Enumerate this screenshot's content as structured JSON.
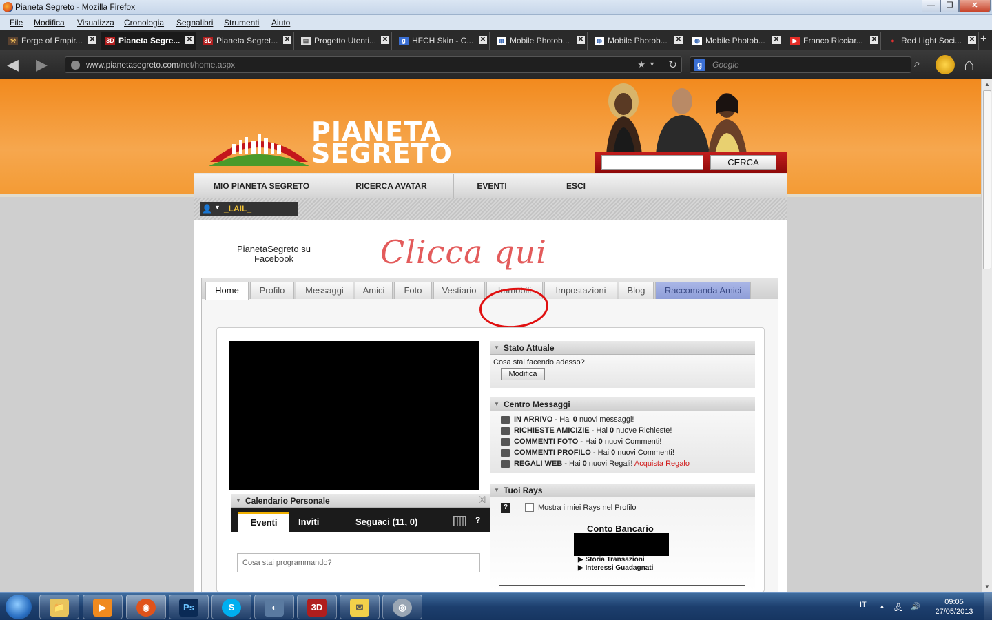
{
  "window": {
    "title": "Pianeta Segreto - Mozilla Firefox",
    "controls": {
      "minimize": "—",
      "maximize": "❐",
      "close": "✕"
    }
  },
  "menu": [
    "File",
    "Modifica",
    "Visualizza",
    "Cronologia",
    "Segnalibri",
    "Strumenti",
    "Aiuto"
  ],
  "tabs": [
    {
      "label": "Forge of Empir...",
      "icon": "forge-icon",
      "active": false
    },
    {
      "label": "Pianeta Segre...",
      "icon": "3d-icon",
      "active": true
    },
    {
      "label": "Pianeta Segret...",
      "icon": "3d-icon",
      "active": false
    },
    {
      "label": "Progetto Utenti...",
      "icon": "page-icon",
      "active": false
    },
    {
      "label": "HFCH Skin - C...",
      "icon": "g-icon",
      "active": false
    },
    {
      "label": "Mobile Photob...",
      "icon": "photobucket-icon",
      "active": false
    },
    {
      "label": "Mobile Photob...",
      "icon": "photobucket-icon",
      "active": false
    },
    {
      "label": "Mobile Photob...",
      "icon": "photobucket-icon",
      "active": false
    },
    {
      "label": "Franco Ricciar...",
      "icon": "youtube-icon",
      "active": false
    },
    {
      "label": "Red Light Soci...",
      "icon": "red-light-icon",
      "active": false
    }
  ],
  "tab_close": "✕",
  "new_tab": "+",
  "nav": {
    "url_prefix": "www.pianetasegreto.com",
    "url_path": "/net/home.aspx",
    "search_placeholder": "Google",
    "search_engine_glyph": "g"
  },
  "site": {
    "logo_line1": "PIANETA",
    "logo_line2": "SEGRETO",
    "search_button": "CERCA",
    "mainnav": [
      "MIO PIANETA SEGRETO",
      "RICERCA AVATAR",
      "EVENTI",
      "ESCI"
    ],
    "username": "_LAIL_",
    "facebook_text": "PianetaSegreto su Facebook",
    "clicca": "Clicca qui",
    "profile_tabs": [
      {
        "label": "Home",
        "active": true
      },
      {
        "label": "Profilo"
      },
      {
        "label": "Messaggi"
      },
      {
        "label": "Amici"
      },
      {
        "label": "Foto"
      },
      {
        "label": "Vestiario"
      },
      {
        "label": "Immobili"
      },
      {
        "label": "Impostazioni"
      },
      {
        "label": "Blog"
      },
      {
        "label": "Raccomanda Amici",
        "special": true
      }
    ]
  },
  "stato": {
    "title": "Stato Attuale",
    "question": "Cosa stai facendo adesso?",
    "button": "Modifica"
  },
  "messages": {
    "title": "Centro Messaggi",
    "rows": [
      {
        "key": "IN ARRIVO",
        "pre": " - Hai ",
        "count": "0",
        "post": " nuovi messaggi!",
        "icon": "envelope-icon"
      },
      {
        "key": "RICHIESTE AMICIZIE",
        "pre": " - Hai ",
        "count": "0",
        "post": " nuove Richieste!",
        "icon": "friends-icon"
      },
      {
        "key": "COMMENTI FOTO",
        "pre": " - Hai ",
        "count": "0",
        "post": " nuovi Commenti!",
        "icon": "photo-comment-icon"
      },
      {
        "key": "COMMENTI PROFILO",
        "pre": " - Hai ",
        "count": "0",
        "post": " nuovi Commenti!",
        "icon": "profile-comment-icon"
      },
      {
        "key": "REGALI WEB",
        "pre": " - Hai ",
        "count": "0",
        "post": " nuovi Regali! ",
        "icon": "gift-icon",
        "link": "Acquista Regalo"
      }
    ]
  },
  "rays": {
    "title": "Tuoi Rays",
    "help_glyph": "?",
    "checkbox_label": "Mostra i miei Rays nel Profilo",
    "conto_title": "Conto Bancario",
    "links": [
      "▶ Storia Transazioni",
      "▶ Interessi Guadagnati"
    ]
  },
  "calendar": {
    "title": "Calendario Personale",
    "close": "[x]",
    "tabs": [
      "Eventi",
      "Inviti",
      "Seguaci (11, 0)"
    ],
    "input_placeholder": "Cosa stai programmando?",
    "help_glyph": "?"
  },
  "taskbar": {
    "apps": [
      {
        "name": "explorer-icon",
        "glyph": "📁"
      },
      {
        "name": "media-player-icon",
        "glyph": "▶"
      },
      {
        "name": "firefox-icon",
        "glyph": "◉"
      },
      {
        "name": "photoshop-icon",
        "glyph": "Ps"
      },
      {
        "name": "skype-icon",
        "glyph": "S"
      },
      {
        "name": "network-app-icon",
        "glyph": "◐"
      },
      {
        "name": "3d-app-icon",
        "glyph": "3D"
      },
      {
        "name": "messenger-icon",
        "glyph": "✉"
      },
      {
        "name": "speaker-app-icon",
        "glyph": "◎"
      }
    ],
    "lang": "IT",
    "time": "09:05",
    "date": "27/05/2013"
  },
  "colors": {
    "header_orange": "#f28a1e",
    "red_accent": "#c21d1d",
    "username_gold": "#f0c238",
    "circle_red": "#e01010",
    "clicca_pink": "#e35b5b"
  }
}
